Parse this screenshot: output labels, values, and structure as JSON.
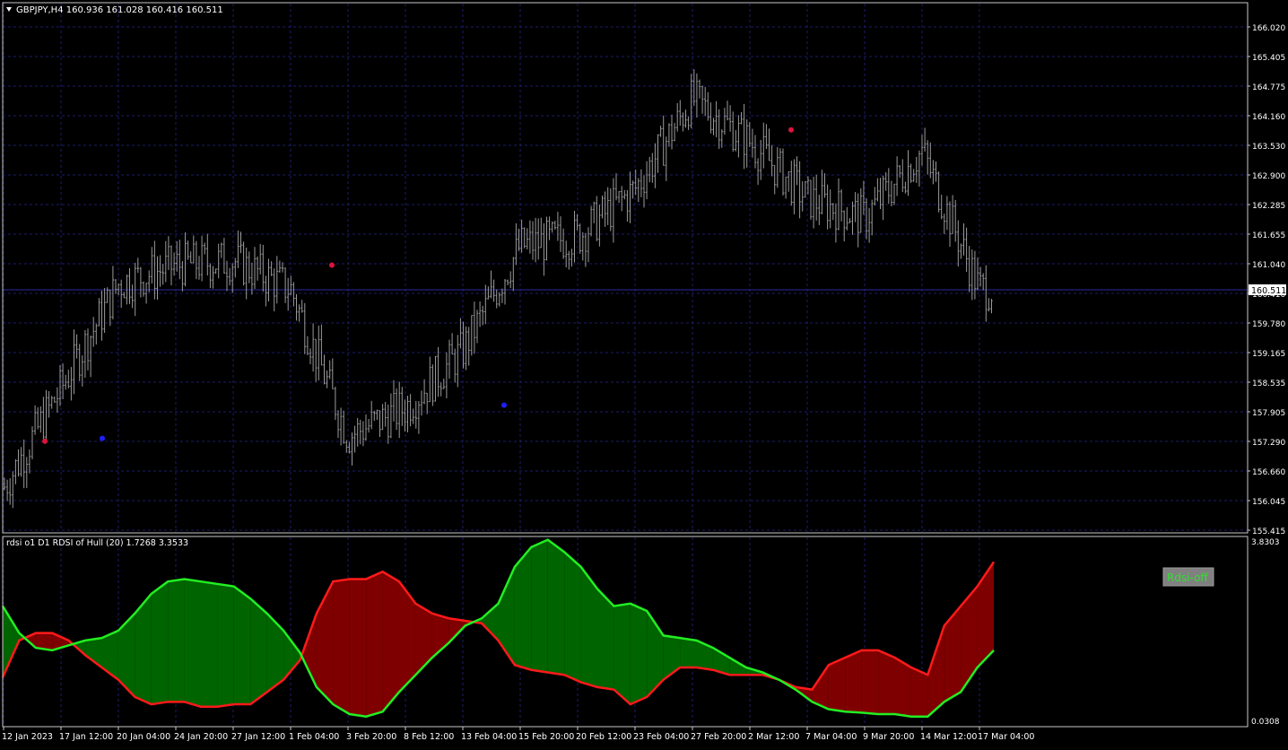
{
  "main_panel": {
    "header": "GBPJPY,H4  160.936 161.028 160.416 160.511",
    "price_labels": [
      "166.020",
      "165.405",
      "164.775",
      "164.160",
      "163.530",
      "162.900",
      "162.285",
      "161.655",
      "161.040",
      "160.410",
      "159.780",
      "159.165",
      "158.535",
      "157.905",
      "157.290",
      "156.660",
      "156.045",
      "155.415"
    ],
    "current_price": "160.511"
  },
  "indicator_panel": {
    "header": "rdsi o1 D1 RDSI of Hull (20) 1.7268 3.3533",
    "scale_max": "3.8303",
    "scale_min": "0.0308",
    "button_label": "Rdsi-off"
  },
  "time_labels": [
    "12 Jan 2023",
    "17 Jan 12:00",
    "20 Jan 04:00",
    "24 Jan 20:00",
    "27 Jan 12:00",
    "1 Feb 04:00",
    "3 Feb 20:00",
    "8 Feb 12:00",
    "13 Feb 04:00",
    "15 Feb 20:00",
    "20 Feb 12:00",
    "23 Feb 04:00",
    "27 Feb 20:00",
    "2 Mar 12:00",
    "7 Mar 04:00",
    "9 Mar 20:00",
    "14 Mar 12:00",
    "17 Mar 04:00"
  ],
  "colors": {
    "background": "#000000",
    "grid": "#1c1c6a",
    "candles": "#9a9a9a",
    "green_line": "#22ee22",
    "red_line": "#ff1a1a",
    "green_fill": "#006400",
    "red_fill": "#7f0000",
    "dot_red": "#dc143c",
    "dot_blue": "#1e1eff",
    "button_bg": "#808080",
    "button_text": "#33dd33"
  },
  "chart_data": [
    {
      "type": "candlestick",
      "title": "GBPJPY,H4",
      "ohlc_last": {
        "open": 160.936,
        "high": 161.028,
        "low": 160.416,
        "close": 160.511
      },
      "ylim": [
        155.415,
        166.02
      ],
      "series": [
        {
          "name": "close",
          "x": [
            "12 Jan 2023",
            "17 Jan 12:00",
            "20 Jan 04:00",
            "24 Jan 20:00",
            "27 Jan 12:00",
            "1 Feb 04:00",
            "3 Feb 20:00",
            "8 Feb 12:00",
            "13 Feb 04:00",
            "15 Feb 20:00",
            "20 Feb 12:00",
            "23 Feb 04:00",
            "27 Feb 20:00",
            "2 Mar 12:00",
            "7 Mar 04:00",
            "9 Mar 20:00",
            "14 Mar 12:00",
            "17 Mar 04:00"
          ],
          "values": [
            156.3,
            158.4,
            160.6,
            161.0,
            161.1,
            160.5,
            157.4,
            158.0,
            159.2,
            161.4,
            161.6,
            162.6,
            164.5,
            163.6,
            162.4,
            162.0,
            163.4,
            160.5
          ]
        }
      ],
      "markers": [
        {
          "x": "12 Jan 2023",
          "y": 157.29,
          "color": "red"
        },
        {
          "x": "17 Jan 12:00",
          "y": 157.35,
          "color": "blue"
        },
        {
          "x": "1 Feb 04:00",
          "y": 161.0,
          "color": "red"
        },
        {
          "x": "13 Feb 04:00",
          "y": 158.05,
          "color": "blue"
        },
        {
          "x": "2 Mar 12:00",
          "y": 163.85,
          "color": "red"
        }
      ]
    },
    {
      "type": "area",
      "title": "rdsi o1 D1 RDSI of Hull (20)",
      "ylim": [
        0.0308,
        3.8303
      ],
      "series": [
        {
          "name": "green",
          "values": [
            2.45,
            1.9,
            1.6,
            1.55,
            1.65,
            1.75,
            1.8,
            1.95,
            2.3,
            2.7,
            2.95,
            3.0,
            2.95,
            2.9,
            2.85,
            2.6,
            2.3,
            1.95,
            1.5,
            0.8,
            0.45,
            0.25,
            0.2,
            0.3,
            0.7,
            1.05,
            1.4,
            1.7,
            2.05,
            2.2,
            2.5,
            3.25,
            3.65,
            3.8,
            3.55,
            3.25,
            2.8,
            2.45,
            2.5,
            2.35,
            1.85,
            1.8,
            1.75,
            1.6,
            1.4,
            1.2,
            1.1,
            0.95,
            0.75,
            0.5,
            0.35,
            0.3,
            0.28,
            0.25,
            0.25,
            0.2,
            0.2,
            0.5,
            0.7,
            1.2,
            1.55
          ]
        },
        {
          "name": "red",
          "values": [
            1.0,
            1.75,
            1.9,
            1.9,
            1.75,
            1.45,
            1.2,
            0.95,
            0.6,
            0.45,
            0.5,
            0.5,
            0.4,
            0.4,
            0.45,
            0.45,
            0.7,
            0.95,
            1.35,
            2.3,
            2.95,
            3.0,
            3.0,
            3.15,
            2.95,
            2.5,
            2.3,
            2.2,
            2.15,
            2.1,
            1.75,
            1.25,
            1.15,
            1.1,
            1.05,
            0.9,
            0.8,
            0.75,
            0.45,
            0.6,
            0.95,
            1.2,
            1.2,
            1.15,
            1.05,
            1.05,
            1.05,
            0.95,
            0.8,
            0.75,
            1.25,
            1.4,
            1.55,
            1.55,
            1.4,
            1.2,
            1.05,
            2.05,
            2.45,
            2.85,
            3.35
          ]
        }
      ]
    }
  ]
}
